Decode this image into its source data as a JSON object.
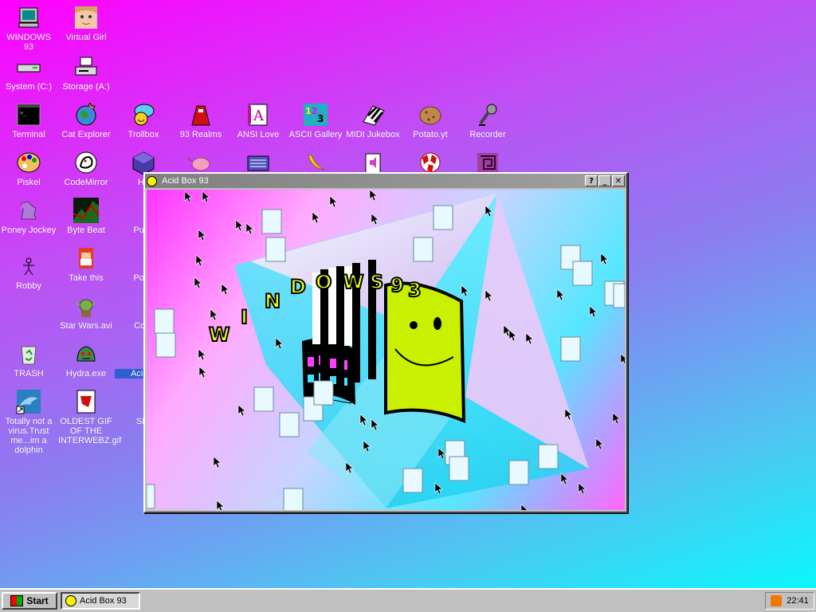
{
  "desktop": {
    "icons": {
      "windows93": "WINDOWS 93",
      "virtual_girl": "Virtual Girl",
      "system_c": "System (C:)",
      "storage_a": "Storage (A:)",
      "terminal": "Terminal",
      "cat_explorer": "Cat Explorer",
      "trollbox": "Trollbox",
      "realms": "93 Realms",
      "ansi_love": "ANSI Love",
      "ascii_gallery": "ASCII Gallery",
      "midi_jukebox": "MIDI Jukebox",
      "potato": "Potato.yt",
      "recorder": "Recorder",
      "piskel": "Piskel",
      "codemirror": "CodeMirror",
      "hex": "He",
      "poney": "Poney Jockey",
      "byte_beat": "Byte Beat",
      "puke": "Puke",
      "robby": "Robby",
      "take_this": "Take this",
      "poke": "Poké",
      "star_wars": "Star Wars.avi",
      "corg": "Corg",
      "trash": "TRASH",
      "hydra": "Hydra.exe",
      "acid_b": "Acid B",
      "dolphin": "Totally not a virus.Trust me...im a dolphin",
      "oldest_gif": "OLDEST GIF OF THE INTERWEBZ.gif",
      "sin": "SIN"
    }
  },
  "window": {
    "title": "Acid Box 93",
    "help_label": "?",
    "minimize_label": "_",
    "close_label": "✕"
  },
  "artwork": {
    "letters": [
      "W",
      "I",
      "N",
      "D",
      "O",
      "W",
      "S",
      "9",
      "3"
    ]
  },
  "taskbar": {
    "start_label": "Start",
    "task_label": "Acid Box 93",
    "clock": "22:41"
  },
  "colors": {
    "accent": "#2f5fd0",
    "window_title_bg": "#808080",
    "chrome": "#c0c0c0"
  }
}
